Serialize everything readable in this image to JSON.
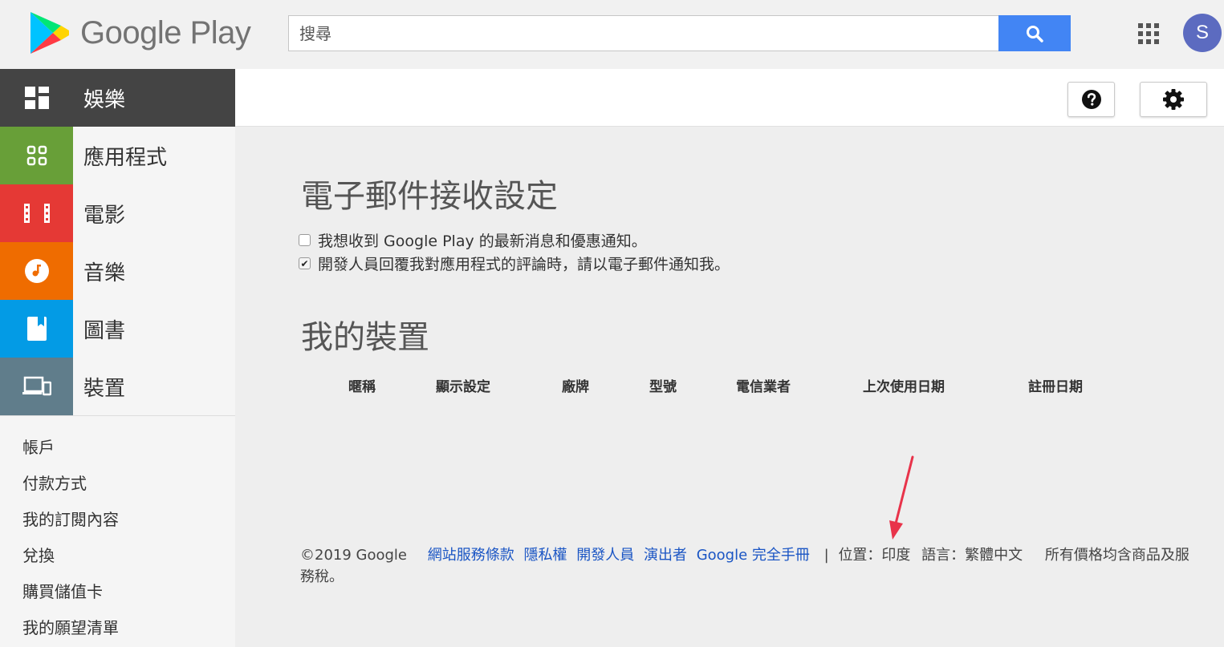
{
  "header": {
    "logo_text": "Google Play",
    "search_placeholder": "搜尋",
    "avatar_letter": "S"
  },
  "sidebar": {
    "categories": [
      {
        "label": "娛樂",
        "icon": "entertainment-icon",
        "color": "#444444"
      },
      {
        "label": "應用程式",
        "icon": "apps-icon",
        "color": "#689f38"
      },
      {
        "label": "電影",
        "icon": "movie-icon",
        "color": "#e53935"
      },
      {
        "label": "音樂",
        "icon": "music-icon",
        "color": "#ef6c00"
      },
      {
        "label": "圖書",
        "icon": "book-icon",
        "color": "#039be5"
      },
      {
        "label": "裝置",
        "icon": "devices-icon",
        "color": "#607d8b"
      }
    ],
    "account_links": [
      "帳戶",
      "付款方式",
      "我的訂閱內容",
      "兌換",
      "購買儲值卡",
      "我的願望清單"
    ]
  },
  "main": {
    "email_title": "電子郵件接收設定",
    "checkboxes": [
      {
        "label": "我想收到 Google Play 的最新消息和優惠通知。",
        "checked": false
      },
      {
        "label": "開發人員回覆我對應用程式的評論時，請以電子郵件通知我。",
        "checked": true
      }
    ],
    "devices_title": "我的裝置",
    "device_columns": [
      "暱稱",
      "顯示設定",
      "廠牌",
      "型號",
      "電信業者",
      "上次使用日期",
      "註冊日期"
    ]
  },
  "footer": {
    "copyright": "©2019 Google",
    "links": [
      "網站服務條款",
      "隱私權",
      "開發人員",
      "演出者",
      "Google 完全手冊"
    ],
    "separator": "|",
    "location": "位置：印度",
    "language": "語言：繁體中文",
    "tax_note": "所有價格均含商品及服務稅。"
  },
  "colors": {
    "accent": "#4285f4",
    "link": "#1a55c4",
    "annotation_arrow": "#e8334a"
  }
}
